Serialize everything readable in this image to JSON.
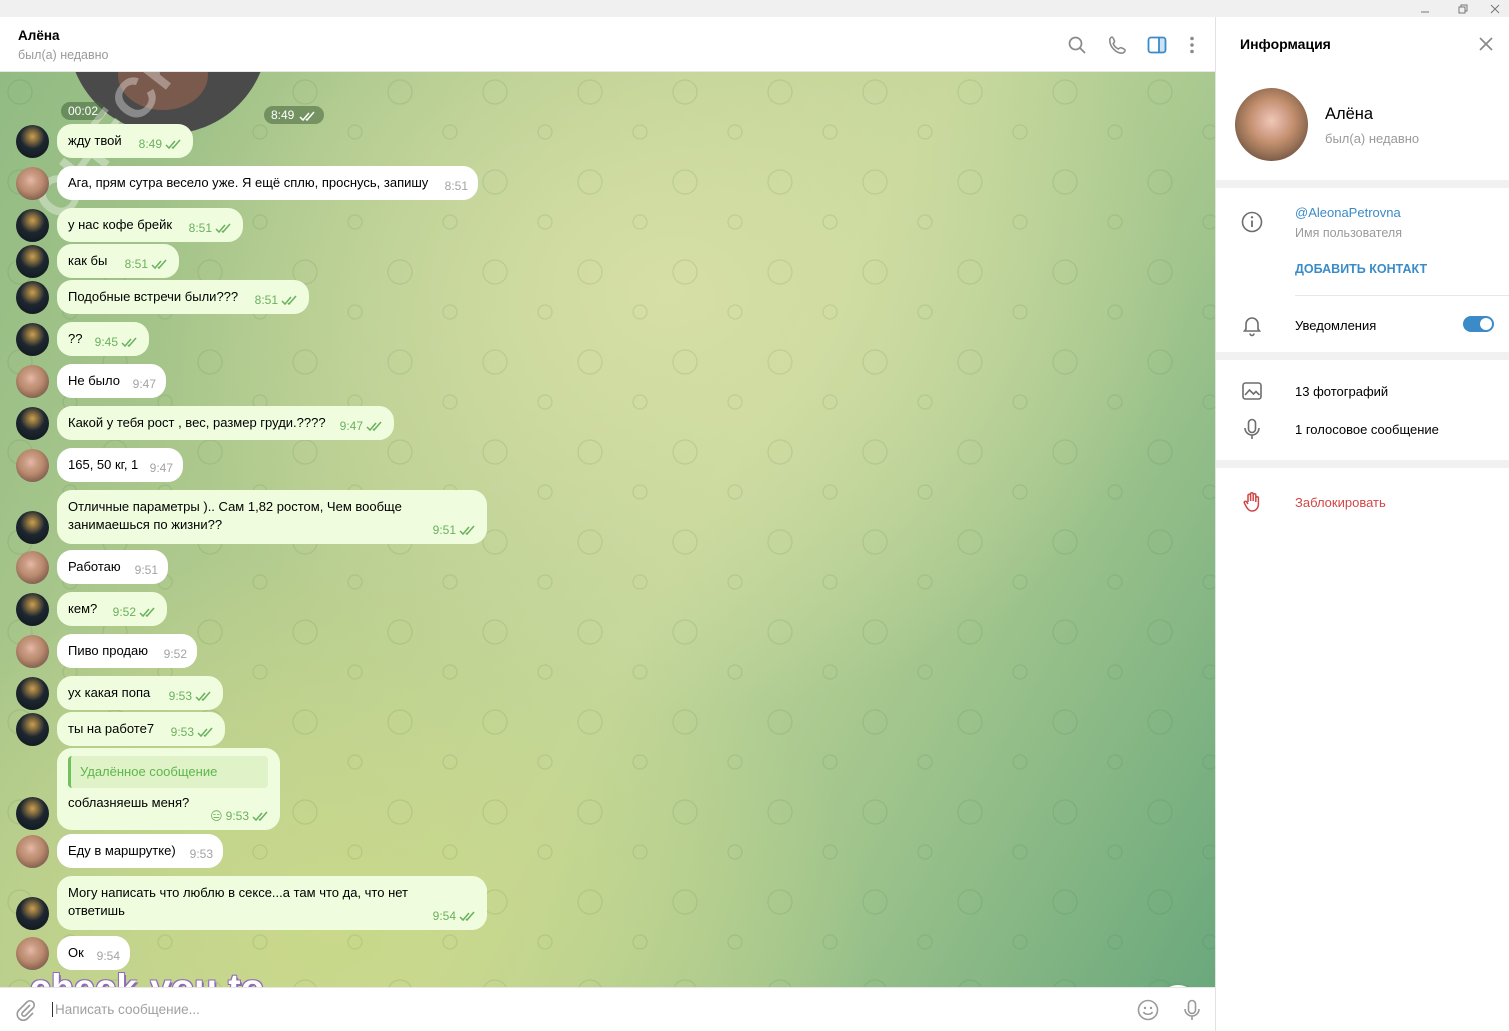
{
  "chat": {
    "title": "Алёна",
    "status": "был(а) недавно",
    "video_duration": "00:02",
    "video_time": "8:49",
    "messages": [
      {
        "from": "me",
        "text": "жду твой",
        "time": "8:49"
      },
      {
        "from": "her",
        "text": "Ага, прям сутра весело уже. Я ещё сплю, проснусь, запишу",
        "time": "8:51"
      },
      {
        "from": "me",
        "text": "у нас кофе брейк",
        "time": "8:51"
      },
      {
        "from": "me",
        "text": "как бы",
        "time": "8:51"
      },
      {
        "from": "me",
        "text": "Подобные встречи были???",
        "time": "8:51"
      },
      {
        "from": "me",
        "text": "??",
        "time": "9:45"
      },
      {
        "from": "her",
        "text": "Не было",
        "time": "9:47"
      },
      {
        "from": "me",
        "text": "Какой у тебя рост , вес, размер груди.????",
        "time": "9:47"
      },
      {
        "from": "her",
        "text": "165, 50 кг, 1",
        "time": "9:47"
      },
      {
        "from": "me",
        "text": "Отличные параметры ).. Сам 1,82 ростом, Чем вообще\nзанимаешься по жизни??",
        "time": "9:51"
      },
      {
        "from": "her",
        "text": "Работаю",
        "time": "9:51"
      },
      {
        "from": "me",
        "text": "кем?",
        "time": "9:52"
      },
      {
        "from": "her",
        "text": "Пиво продаю",
        "time": "9:52"
      },
      {
        "from": "me",
        "text": "ух какая попа",
        "time": "9:53"
      },
      {
        "from": "me",
        "text": "ты на работе7",
        "time": "9:53"
      },
      {
        "from": "me",
        "quote": "Удалённое сообщение",
        "text": "соблазняешь меня?",
        "emoji": "😑",
        "time": "9:53"
      },
      {
        "from": "her",
        "text": "Еду в маршрутке)",
        "time": "9:53"
      },
      {
        "from": "me",
        "text": "Могу написать что люблю в сексе...а там что да, что нет\nответишь",
        "time": "9:54"
      },
      {
        "from": "her",
        "text": "Ок",
        "time": "9:54"
      }
    ],
    "composer_placeholder": "Написать сообщение...",
    "watermark": "check-you.to",
    "watermark_diagonal": "CHECK-YOU.ME"
  },
  "info": {
    "title": "Информация",
    "name": "Алёна",
    "status": "был(а) недавно",
    "username": "@AleonaPetrovna",
    "username_label": "Имя пользователя",
    "add_contact": "ДОБАВИТЬ КОНТАКТ",
    "notifications": "Уведомления",
    "notifications_on": true,
    "photos": "13 фотографий",
    "voice": "1 голосовое сообщение",
    "block": "Заблокировать"
  },
  "colors": {
    "outgoing_bubble": "#effdde",
    "incoming_bubble": "#ffffff",
    "accent": "#3a8bc8",
    "danger": "#d14646",
    "check": "#6bb05e"
  },
  "icons": [
    "search-icon",
    "phone-icon",
    "sidebar-icon",
    "more-icon",
    "close-icon",
    "info-icon",
    "bell-icon",
    "photo-icon",
    "mic-icon",
    "hand-icon",
    "attach-icon",
    "emoji-icon",
    "chevron-down-icon"
  ]
}
